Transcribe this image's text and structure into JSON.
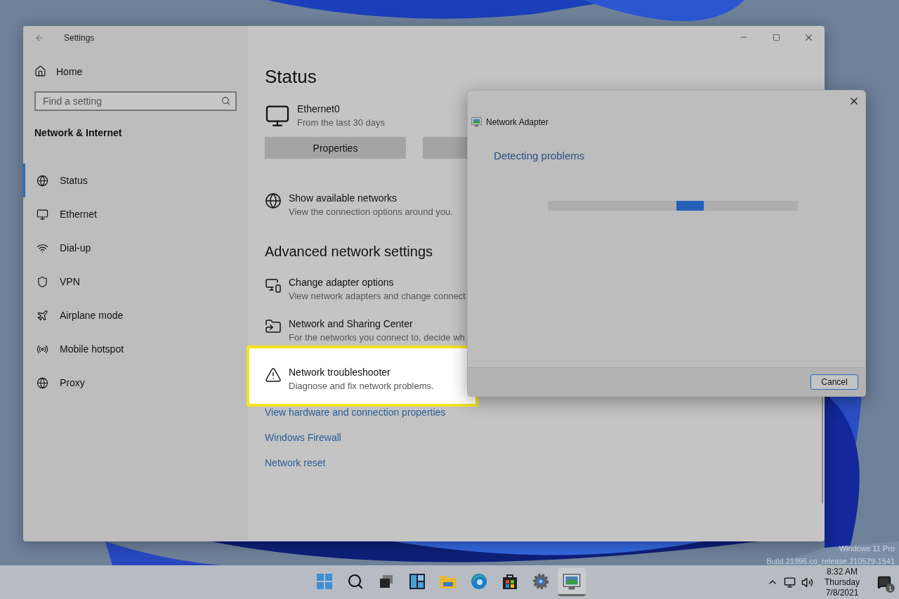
{
  "settings_window": {
    "title": "Settings",
    "sidebar": {
      "home": "Home",
      "search": {
        "placeholder": "Find a setting"
      },
      "heading": "Network & Internet",
      "items": [
        {
          "label": "Status",
          "kind": "globe",
          "selected": true
        },
        {
          "label": "Ethernet",
          "kind": "ethernet",
          "selected": false
        },
        {
          "label": "Dial-up",
          "kind": "dialup",
          "selected": false
        },
        {
          "label": "VPN",
          "kind": "vpn",
          "selected": false
        },
        {
          "label": "Airplane mode",
          "kind": "plane",
          "selected": false
        },
        {
          "label": "Mobile hotspot",
          "kind": "hotspot",
          "selected": false
        },
        {
          "label": "Proxy",
          "kind": "proxy",
          "selected": false
        }
      ]
    },
    "main": {
      "title": "Status",
      "connection": {
        "name": "Ethernet0",
        "subtitle": "From the last 30 days"
      },
      "buttons": [
        "Properties"
      ],
      "show_networks": {
        "title": "Show available networks",
        "subtitle": "View the connection options around you.",
        "kind": "globe"
      },
      "advanced_heading": "Advanced network settings",
      "advanced_items": [
        {
          "title": "Change adapter options",
          "subtitle": "View network adapters and change connect",
          "kind": "adapter",
          "highlighted": false
        },
        {
          "title": "Network and Sharing Center",
          "subtitle": "For the networks you connect to, decide wh",
          "kind": "sharing",
          "highlighted": false
        },
        {
          "title": "Network troubleshooter",
          "subtitle": "Diagnose and fix network problems.",
          "kind": "warning",
          "highlighted": true
        }
      ],
      "links": [
        "View hardware and connection properties",
        "Windows Firewall",
        "Network reset"
      ]
    }
  },
  "dialog": {
    "title": "Network Adapter",
    "heading": "Detecting problems",
    "progress": {
      "level": 0.57
    },
    "buttons": [
      "Cancel"
    ]
  },
  "desktop_watermark": [
    "Windows 11 Pro",
    "Build 21996.co_release.210529-1541"
  ],
  "taskbar": {
    "apps": [
      {
        "kind": "start",
        "active": false
      },
      {
        "kind": "search",
        "active": false
      },
      {
        "kind": "taskview",
        "active": false
      },
      {
        "kind": "widgets",
        "active": false
      },
      {
        "kind": "explorer",
        "active": false
      },
      {
        "kind": "edge",
        "active": false
      },
      {
        "kind": "store",
        "active": false
      },
      {
        "kind": "settings",
        "active": false
      },
      {
        "kind": "adapter",
        "active": true
      }
    ],
    "clock": {
      "time": "8:32 AM",
      "day": "Thursday",
      "date": "7/8/2021"
    },
    "notifications": "1"
  }
}
